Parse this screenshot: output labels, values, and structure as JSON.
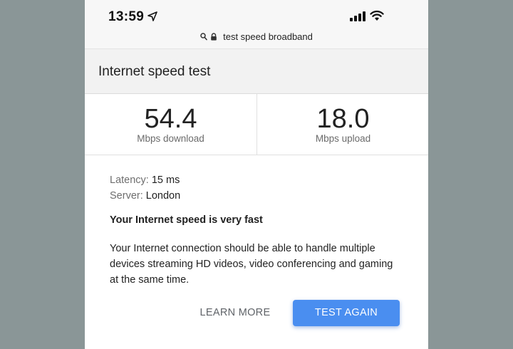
{
  "status_bar": {
    "time": "13:59",
    "icons": [
      "location-arrow-icon",
      "cellular-signal-icon",
      "wifi-icon"
    ]
  },
  "url_bar": {
    "query": "test speed broadband",
    "icons": [
      "search-icon",
      "lock-icon"
    ]
  },
  "card": {
    "title": "Internet speed test",
    "download": {
      "value": "54.4",
      "label": "Mbps download"
    },
    "upload": {
      "value": "18.0",
      "label": "Mbps upload"
    },
    "latency": {
      "key": "Latency:",
      "value": "15 ms"
    },
    "server": {
      "key": "Server:",
      "value": "London"
    },
    "verdict": "Your Internet speed is very fast",
    "description": "Your Internet connection should be able to handle multiple devices streaming HD videos, video conferencing and gaming at the same time.",
    "buttons": {
      "learn_more": "LEARN MORE",
      "test_again": "TEST AGAIN"
    }
  },
  "colors": {
    "background": "#8a9697",
    "accent": "#4a8ef0",
    "title_bar": "#f2f2f2"
  }
}
